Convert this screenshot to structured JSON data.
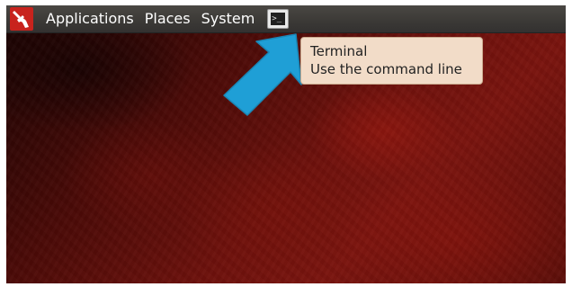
{
  "panel": {
    "menus": [
      "Applications",
      "Places",
      "System"
    ],
    "launcher_glyph": ">_"
  },
  "tooltip": {
    "title": "Terminal",
    "description": "Use the command line"
  },
  "colors": {
    "panel": "#3b3936",
    "logo": "#c8231d",
    "tooltip_bg": "#f2dcc8",
    "arrow": "#1f9fd6"
  },
  "icons": {
    "logo": "red-hat-logo-icon",
    "launcher": "terminal-icon",
    "annotation": "pointer-arrow-icon"
  }
}
